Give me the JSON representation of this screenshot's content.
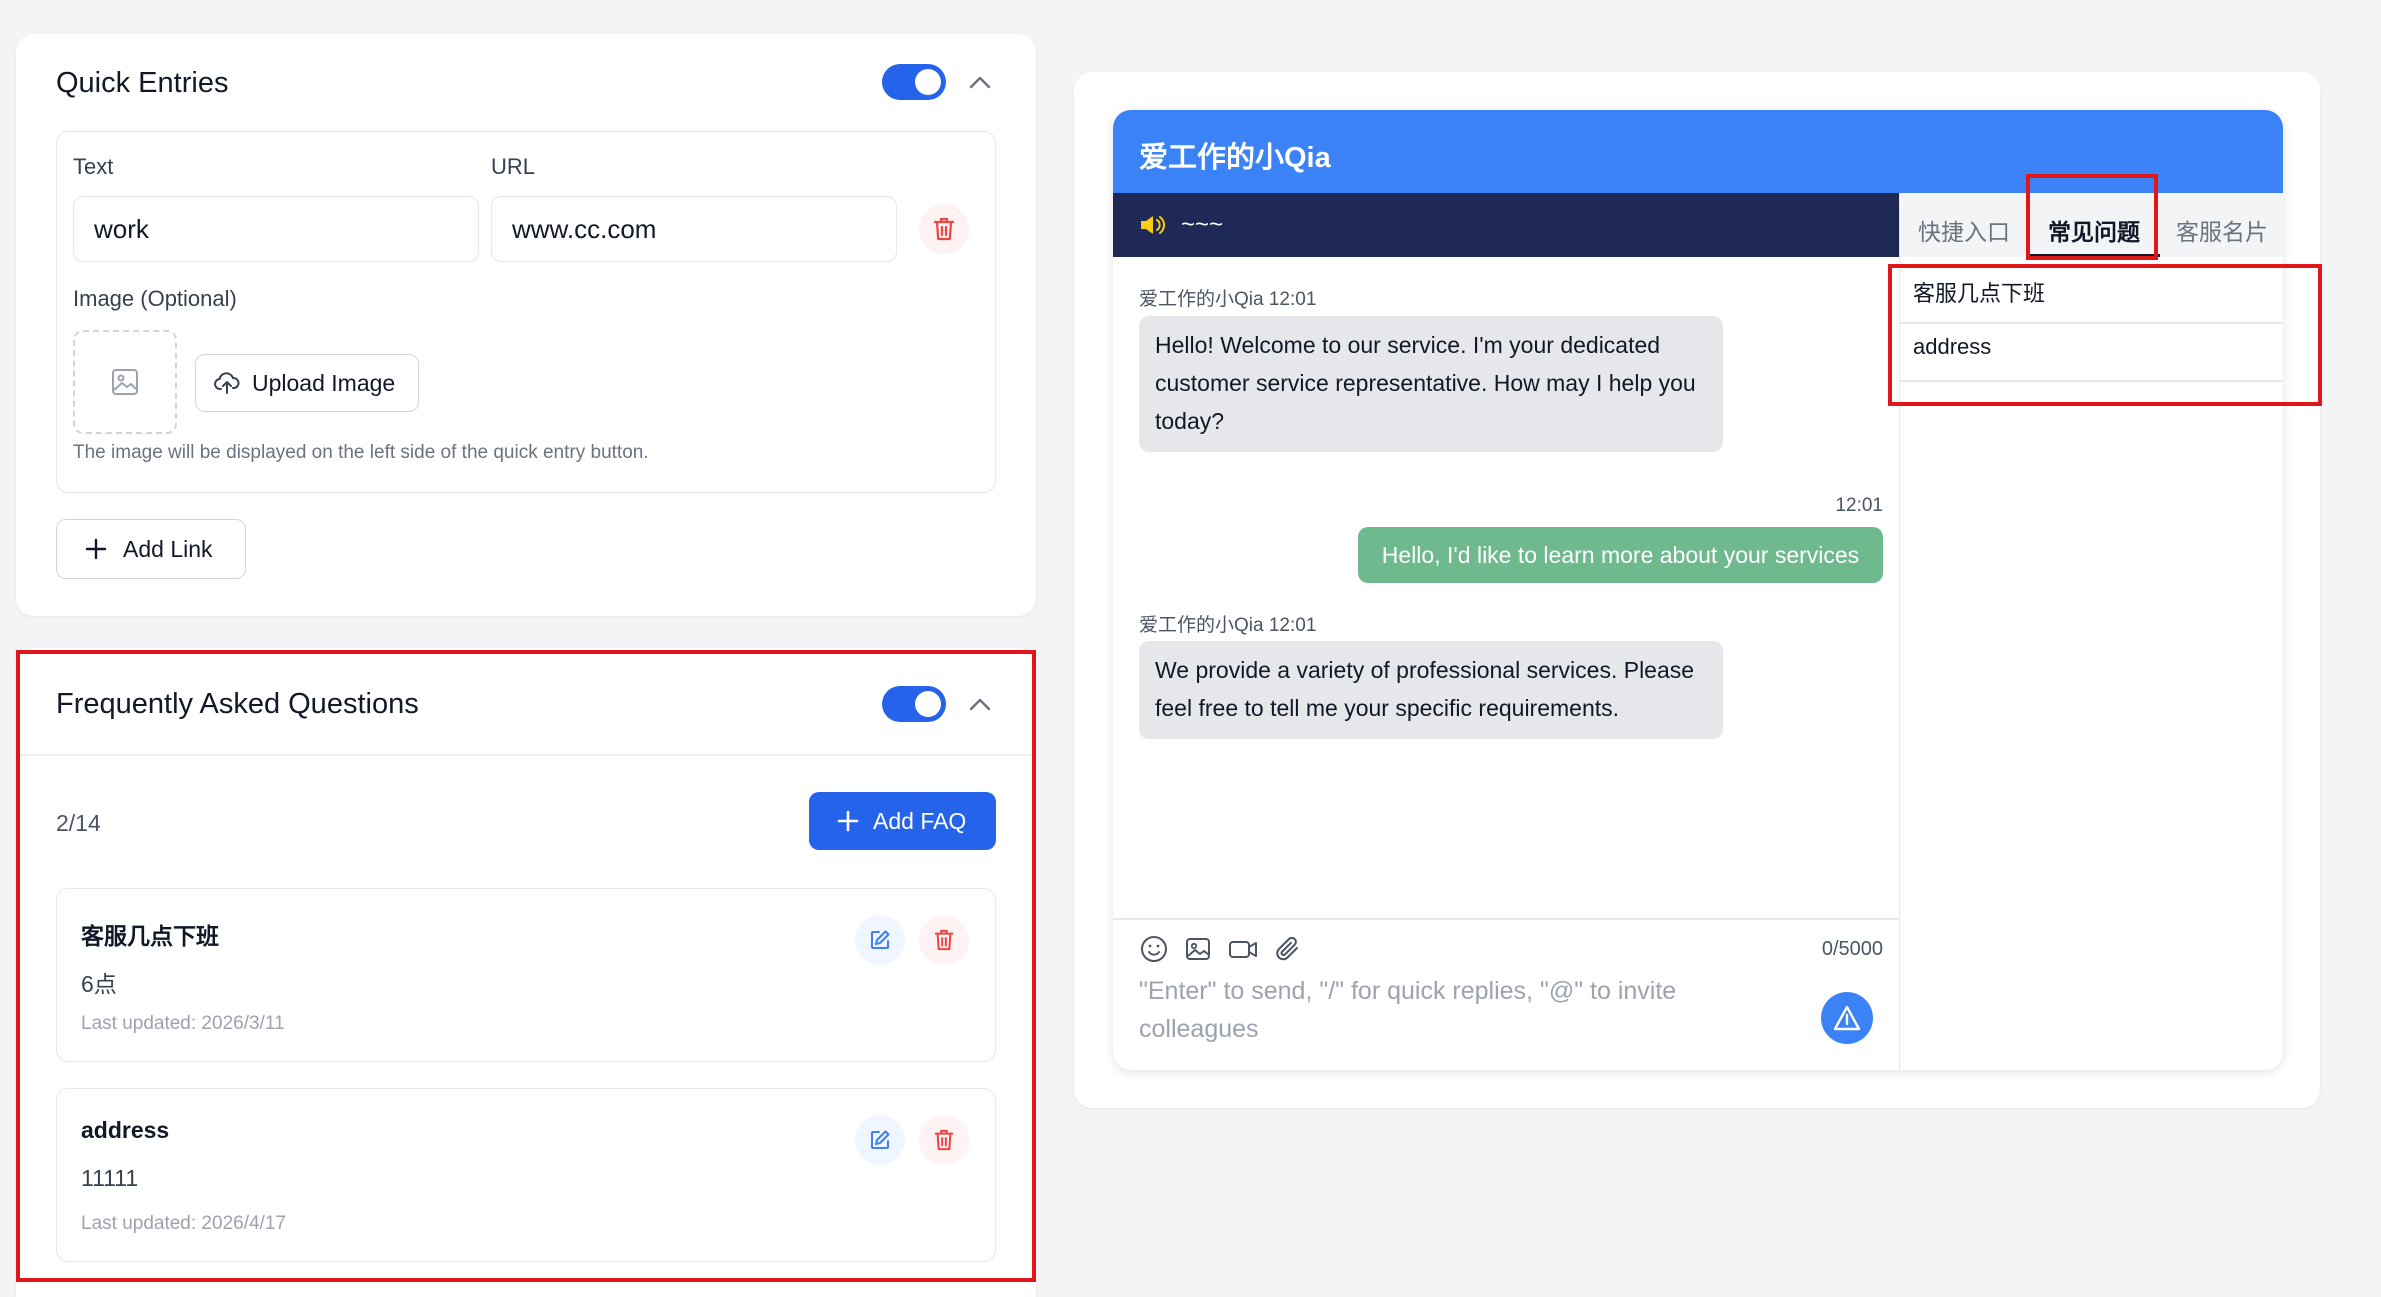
{
  "quick_entries": {
    "title": "Quick Entries",
    "text_label": "Text",
    "url_label": "URL",
    "text_value": "work",
    "url_value": "www.cc.com",
    "image_label": "Image (Optional)",
    "upload_label": "Upload Image",
    "hint": "The image will be displayed on the left side of the quick entry button.",
    "add_link_label": "Add Link"
  },
  "faq": {
    "title": "Frequently Asked Questions",
    "count": "2/14",
    "add_label": "Add FAQ",
    "items": [
      {
        "question": "客服几点下班",
        "answer": "6点",
        "updated": "Last updated: 2026/3/11"
      },
      {
        "question": "address",
        "answer": "11111",
        "updated": "Last updated: 2026/4/17"
      }
    ]
  },
  "preview": {
    "header_title": "爱工作的小Qia",
    "notice": "~~~",
    "tabs": [
      "快捷入口",
      "常见问题",
      "客服名片"
    ],
    "active_tab": "常见问题",
    "faq_list": [
      "客服几点下班",
      "address"
    ],
    "messages": [
      {
        "sender": "爱工作的小Qia 12:01",
        "text": "Hello! Welcome to our service. I'm your dedicated customer service representative. How may I help you today?"
      },
      {
        "time": "12:01",
        "text": "Hello, I'd like to learn more about your services"
      },
      {
        "sender": "爱工作的小Qia 12:01",
        "text": "We provide a variety of professional services. Please feel free to tell me your specific requirements."
      }
    ],
    "char_count": "0/5000",
    "input_placeholder": "\"Enter\" to send, \"/\" for quick replies, \"@\" to invite colleagues"
  },
  "colors": {
    "primary": "#2563eb",
    "header_blue": "#3b82f6",
    "notice_bar": "#1e2a55",
    "user_bubble": "#6fb98f",
    "danger": "#ef4444",
    "highlight_box": "#e0161a"
  },
  "icons": [
    "chevron-up-icon",
    "trash-icon",
    "image-icon",
    "upload-cloud-icon",
    "plus-icon",
    "edit-icon",
    "speaker-icon",
    "emoji-icon",
    "picture-icon",
    "video-icon",
    "paperclip-icon",
    "send-icon"
  ]
}
